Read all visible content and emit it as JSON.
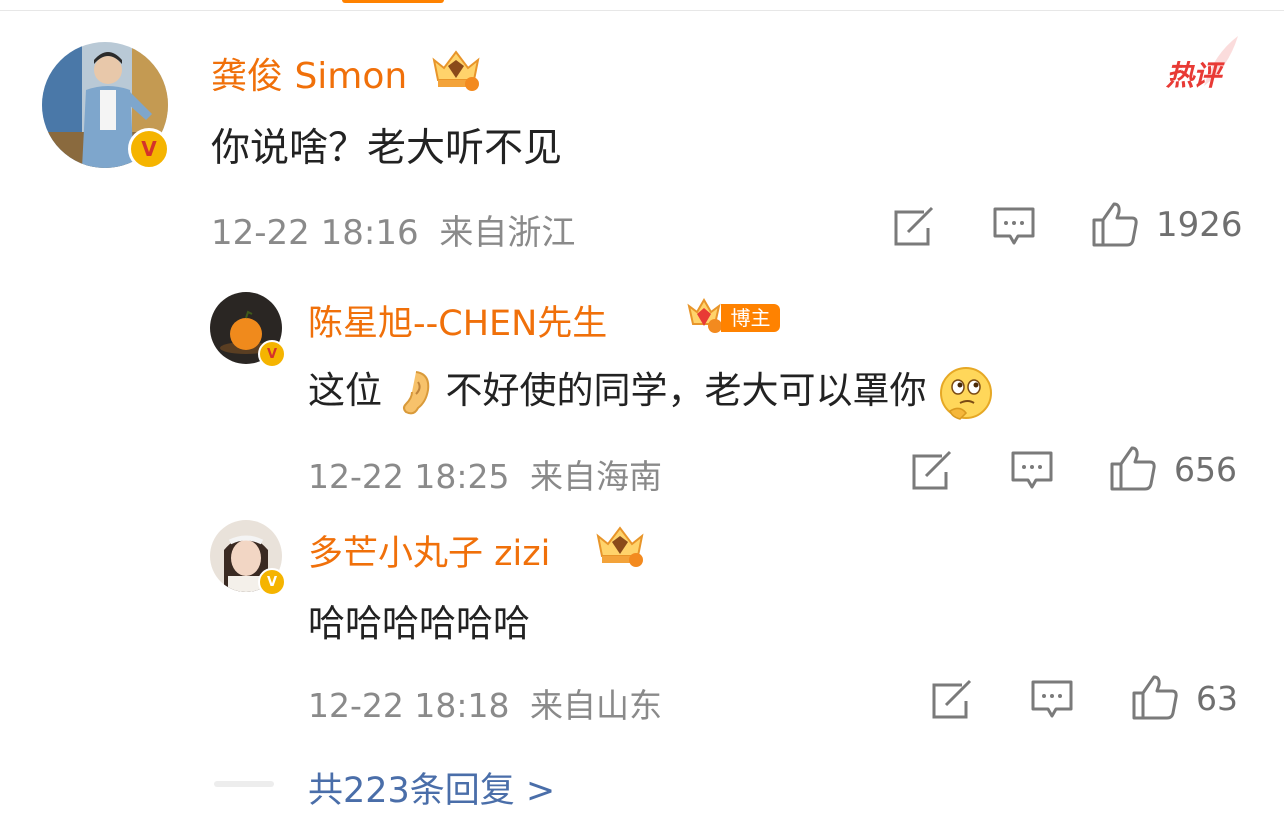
{
  "hot_label": "热评",
  "comments": [
    {
      "name": "龚俊 Simon",
      "text": "你说啥？老大听不见",
      "time": "12-22 18:16",
      "location": "来自浙江",
      "likes": "1926"
    },
    {
      "name": "陈星旭--CHEN先生",
      "badge": "博主",
      "text_a": "这位",
      "text_b": "不好使的同学，老大可以罩你",
      "time": "12-22 18:25",
      "location": "来自海南",
      "likes": "656"
    },
    {
      "name": "多芒小丸子 zizi",
      "text": "哈哈哈哈哈哈",
      "time": "12-22 18:18",
      "location": "来自山东",
      "likes": "63"
    }
  ],
  "replies_link": "共223条回复 >",
  "colors": {
    "accent": "#ff8200",
    "name": "#f0700a",
    "link": "#4a6ea9",
    "hot": "#e83a35"
  }
}
